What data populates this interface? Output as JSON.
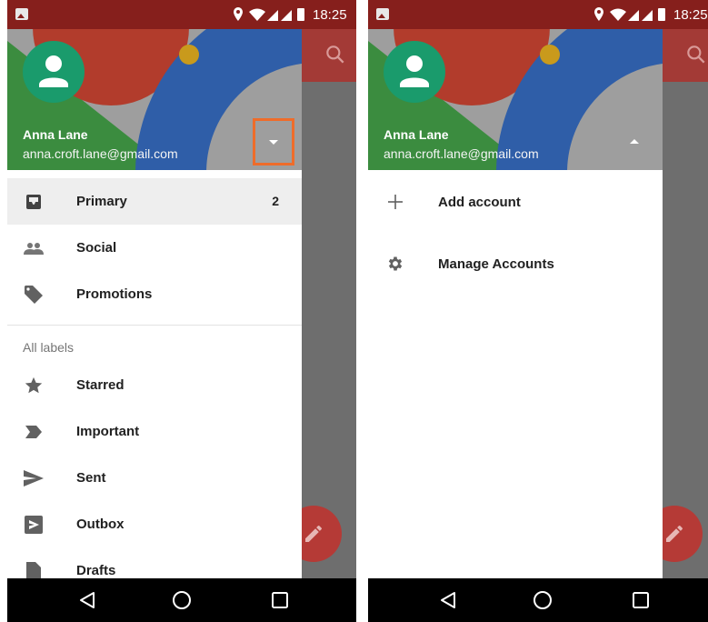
{
  "status_bar": {
    "time": "18:25"
  },
  "account": {
    "name": "Anna Lane",
    "email": "anna.croft.lane@gmail.com"
  },
  "left_drawer": {
    "primary_items": [
      {
        "label": "Primary",
        "count": "2",
        "icon": "inbox-icon",
        "selected": true
      },
      {
        "label": "Social",
        "icon": "people-icon"
      },
      {
        "label": "Promotions",
        "icon": "tag-icon"
      }
    ],
    "section_label": "All labels",
    "label_items": [
      {
        "label": "Starred",
        "icon": "star-icon"
      },
      {
        "label": "Important",
        "icon": "important-icon"
      },
      {
        "label": "Sent",
        "icon": "send-icon"
      },
      {
        "label": "Outbox",
        "icon": "outbox-icon"
      },
      {
        "label": "Drafts",
        "icon": "draft-icon"
      }
    ]
  },
  "right_drawer": {
    "items": [
      {
        "label": "Add account",
        "icon": "plus-icon"
      },
      {
        "label": "Manage Accounts",
        "icon": "gear-icon"
      }
    ]
  },
  "colors": {
    "status_bar": "#861f1c",
    "app_bar": "#a33a36",
    "avatar": "#1a9b6c",
    "highlight": "#ef6c2a"
  }
}
